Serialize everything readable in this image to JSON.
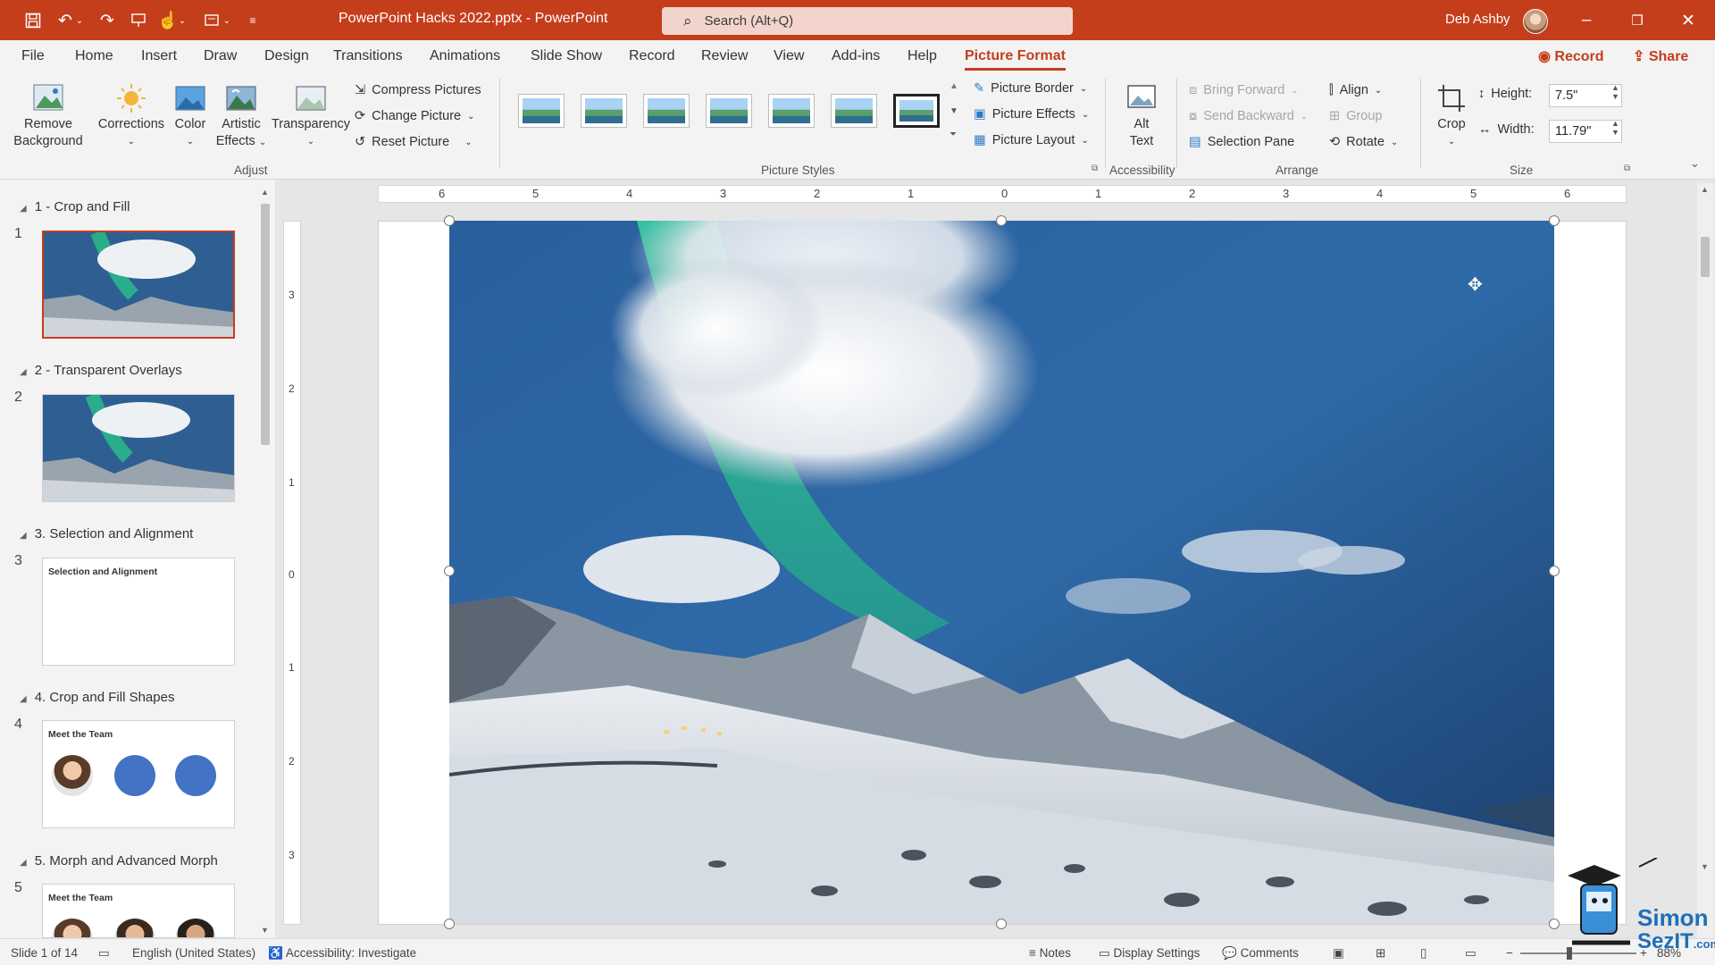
{
  "app": {
    "document_title": "PowerPoint Hacks 2022.pptx  -  PowerPoint",
    "search_placeholder": "Search (Alt+Q)",
    "user_name": "Deb Ashby"
  },
  "tabs": [
    {
      "label": "File"
    },
    {
      "label": "Home"
    },
    {
      "label": "Insert"
    },
    {
      "label": "Draw"
    },
    {
      "label": "Design"
    },
    {
      "label": "Transitions"
    },
    {
      "label": "Animations"
    },
    {
      "label": "Slide Show"
    },
    {
      "label": "Record"
    },
    {
      "label": "Review"
    },
    {
      "label": "View"
    },
    {
      "label": "Add-ins"
    },
    {
      "label": "Help"
    },
    {
      "label": "Picture Format",
      "active": true
    }
  ],
  "tab_right": {
    "record": "Record",
    "share": "Share"
  },
  "ribbon": {
    "adjust": {
      "remove_background_line1": "Remove",
      "remove_background_line2": "Background",
      "corrections": "Corrections",
      "color": "Color",
      "artistic_line1": "Artistic",
      "artistic_line2": "Effects",
      "transparency": "Transparency",
      "compress": "Compress Pictures",
      "change": "Change Picture",
      "reset": "Reset Picture",
      "group_label": "Adjust"
    },
    "picture_styles": {
      "border": "Picture Border",
      "effects": "Picture Effects",
      "layout": "Picture Layout",
      "group_label": "Picture Styles"
    },
    "accessibility": {
      "alt_line1": "Alt",
      "alt_line2": "Text",
      "group_label": "Accessibility"
    },
    "arrange": {
      "bring_forward": "Bring Forward",
      "send_backward": "Send Backward",
      "selection_pane": "Selection Pane",
      "align": "Align",
      "group": "Group",
      "rotate": "Rotate",
      "group_label": "Arrange"
    },
    "size": {
      "crop": "Crop",
      "height_label": "Height:",
      "height_value": "7.5\"",
      "width_label": "Width:",
      "width_value": "11.79\"",
      "group_label": "Size"
    }
  },
  "slides_pane": {
    "sections": [
      {
        "title": "1 - Crop and Fill",
        "num": "1"
      },
      {
        "title": "2 - Transparent Overlays",
        "num": "2"
      },
      {
        "title": "3. Selection and Alignment",
        "num": "3",
        "thumb_title": "Selection and Alignment"
      },
      {
        "title": "4. Crop and Fill Shapes",
        "num": "4",
        "thumb_title": "Meet the Team"
      },
      {
        "title": "5. Morph and Advanced Morph",
        "num": "5",
        "thumb_title": "Meet the Team"
      }
    ]
  },
  "ruler": {
    "horizontal": [
      "6",
      "5",
      "4",
      "3",
      "2",
      "1",
      "0",
      "1",
      "2",
      "3",
      "4",
      "5",
      "6"
    ],
    "vertical": [
      "3",
      "2",
      "1",
      "0",
      "1",
      "2",
      "3"
    ]
  },
  "status": {
    "slide": "Slide 1 of 14",
    "language": "English (United States)",
    "accessibility": "Accessibility: Investigate",
    "notes": "Notes",
    "display": "Display Settings",
    "comments": "Comments",
    "zoom": "88%"
  },
  "watermark": {
    "line1": "Simon",
    "line2": "SezIT",
    "suffix": ".com"
  },
  "colors": {
    "accent": "#c43e1c",
    "title_bar": "#c43e1c"
  }
}
